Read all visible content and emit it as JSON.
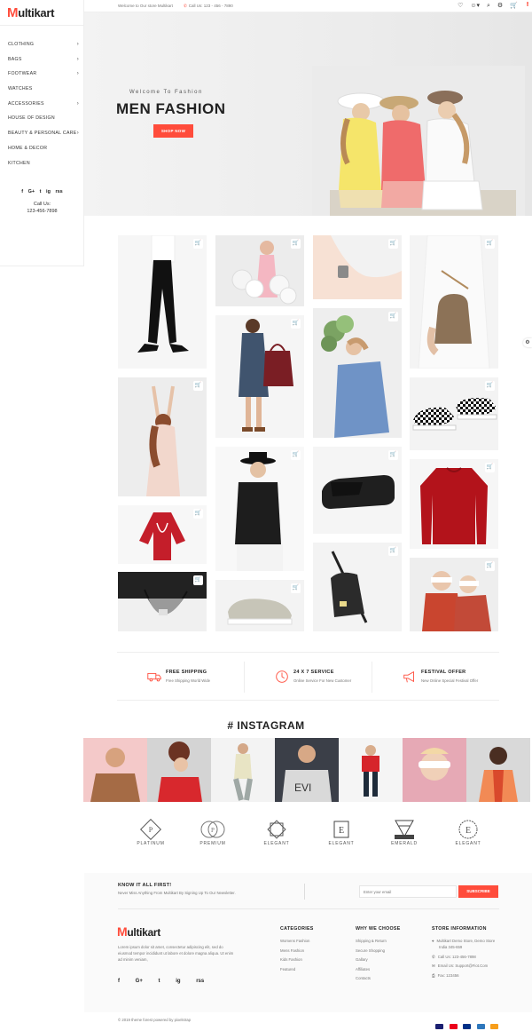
{
  "brand": {
    "logo_first": "M",
    "logo_rest": "ultikart",
    "accent": "#ff4c3b"
  },
  "topbar": {
    "welcome": "Welcome to Our store Multikart",
    "phone": "Call Us: 123 - 456 - 7890",
    "cart_count": "0"
  },
  "sidebar": {
    "items": [
      {
        "label": "Clothing",
        "has_arrow": true
      },
      {
        "label": "Bags",
        "has_arrow": true
      },
      {
        "label": "Footwear",
        "has_arrow": true
      },
      {
        "label": "Watches",
        "has_arrow": false
      },
      {
        "label": "Accessories",
        "has_arrow": true
      },
      {
        "label": "House of Design",
        "has_arrow": false
      },
      {
        "label": "Beauty & Personal Care",
        "has_arrow": true
      },
      {
        "label": "Home & Decor",
        "has_arrow": false
      },
      {
        "label": "Kitchen",
        "has_arrow": false
      }
    ],
    "social": [
      "f",
      "G+",
      "t",
      "ig",
      "rss"
    ],
    "call_label": "Call Us:",
    "call_number": "123-456-7898"
  },
  "hero": {
    "subtitle": "Welcome To Fashion",
    "title": "MEN FASHION",
    "button": "SHOP NOW"
  },
  "services": [
    {
      "title": "FREE SHIPPING",
      "desc": "Free Shipping World Wide",
      "icon": "truck-icon"
    },
    {
      "title": "24 X 7 SERVICE",
      "desc": "Online Service For New Customer",
      "icon": "clock-icon"
    },
    {
      "title": "FESTIVAL OFFER",
      "desc": "New Online Special Festival Offer",
      "icon": "megaphone-icon"
    }
  ],
  "instagram": {
    "title": "# INSTAGRAM"
  },
  "brands": [
    "PLATINUM",
    "PREMIUM",
    "ELEGANT",
    "ELEGANT",
    "EMERALD",
    "ELEGANT"
  ],
  "newsletter": {
    "title": "KNOW IT ALL FIRST!",
    "subtitle": "Never Miss Anything From Multikart By Signing Up To Our Newsletter.",
    "placeholder": "Enter your email",
    "button": "SUBSCRIBE"
  },
  "footer": {
    "about": "Lorem ipsum dolor sit amet, consectetur adipiscing elit, sed do eiusmod tempor incididunt ut labore et dolore magna aliqua. Ut enim ad minim veniam,",
    "categories": {
      "title": "CATEGORIES",
      "items": [
        "Womens Fashion",
        "Mens Fashion",
        "Kids Fashion",
        "Featured"
      ]
    },
    "why": {
      "title": "WHY WE CHOOSE",
      "items": [
        "Shipping & Return",
        "Secure Shopping",
        "Gallary",
        "Affiliates",
        "Contacts"
      ]
    },
    "store": {
      "title": "STORE INFORMATION",
      "address_1": "Multikart Demo Store, Demo Store",
      "address_2": "India 345-659",
      "call": "Call Us: 123-456-7898",
      "email": "Email Us: Support@Fiot.Com",
      "fax": "Fax: 123456"
    },
    "copyright": "© 2019 theme forest powered by pixelstrap"
  }
}
